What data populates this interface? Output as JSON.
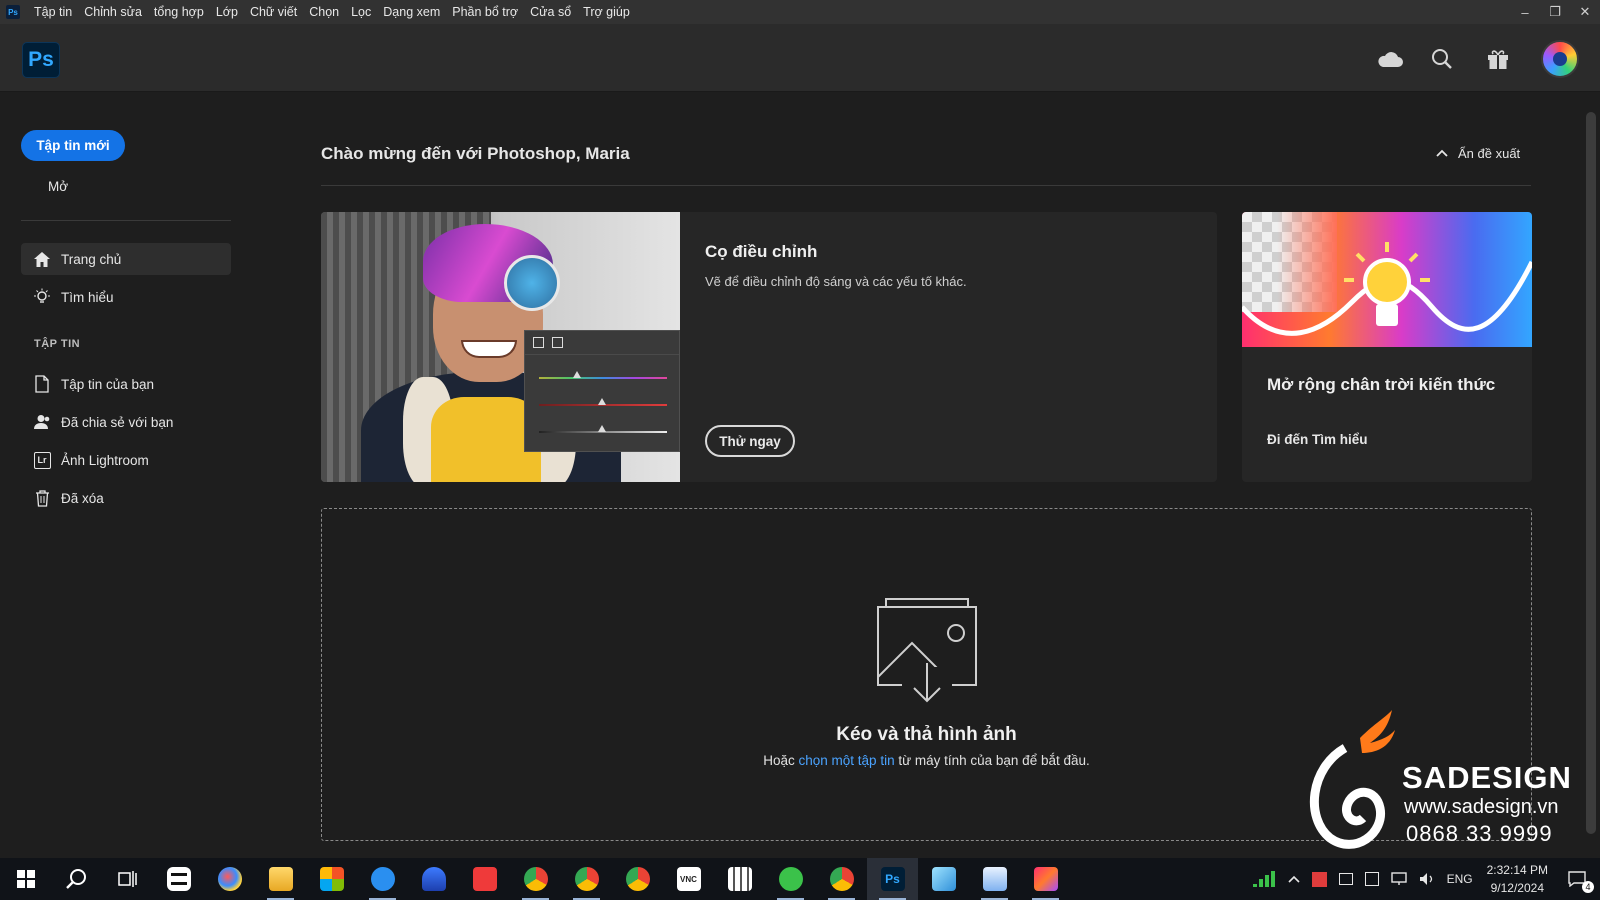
{
  "menubar": {
    "app_badge": "Ps",
    "items": [
      "Tập tin",
      "Chỉnh sửa",
      "tổng hợp",
      "Lớp",
      "Chữ viết",
      "Chọn",
      "Lọc",
      "Dạng xem",
      "Phần bổ trợ",
      "Cửa sổ",
      "Trợ giúp"
    ]
  },
  "header": {
    "logo": "Ps"
  },
  "sidebar": {
    "new_file": "Tập tin mới",
    "open": "Mở",
    "nav": [
      "Trang chủ",
      "Tìm hiểu"
    ],
    "section": "TẬP TIN",
    "files": [
      "Tập tin của bạn",
      "Đã chia sẻ với bạn",
      "Ảnh Lightroom",
      "Đã xóa"
    ],
    "lightroom_badge": "Lr"
  },
  "main": {
    "welcome": "Chào mừng đến với Photoshop, Maria",
    "hide_suggestions": "Ẩn đề xuất",
    "card1": {
      "title": "Cọ điều chỉnh",
      "desc": "Vẽ để điều chỉnh độ sáng và các yếu tố khác.",
      "button": "Thử ngay"
    },
    "card2": {
      "title": "Mở rộng chân trời kiến thức",
      "link": "Đi đến Tìm hiểu"
    },
    "dropzone": {
      "title": "Kéo và thả hình ảnh",
      "prefix": "Hoặc ",
      "link": "chọn một tập tin",
      "suffix": " từ máy tính của bạn để bắt đầu."
    }
  },
  "watermark": {
    "brand": "SADESIGN",
    "site": "www.sadesign.vn",
    "phone": "0868 33 9999"
  },
  "taskbar": {
    "ps_label": "Ps",
    "vnc_label": "VNC",
    "lang": "ENG",
    "time": "2:32:14 PM",
    "date": "9/12/2024",
    "notif_count": "4"
  },
  "colors": {
    "accent": "#1473e6",
    "ps_blue": "#31a8ff",
    "link": "#4aa3ff"
  }
}
